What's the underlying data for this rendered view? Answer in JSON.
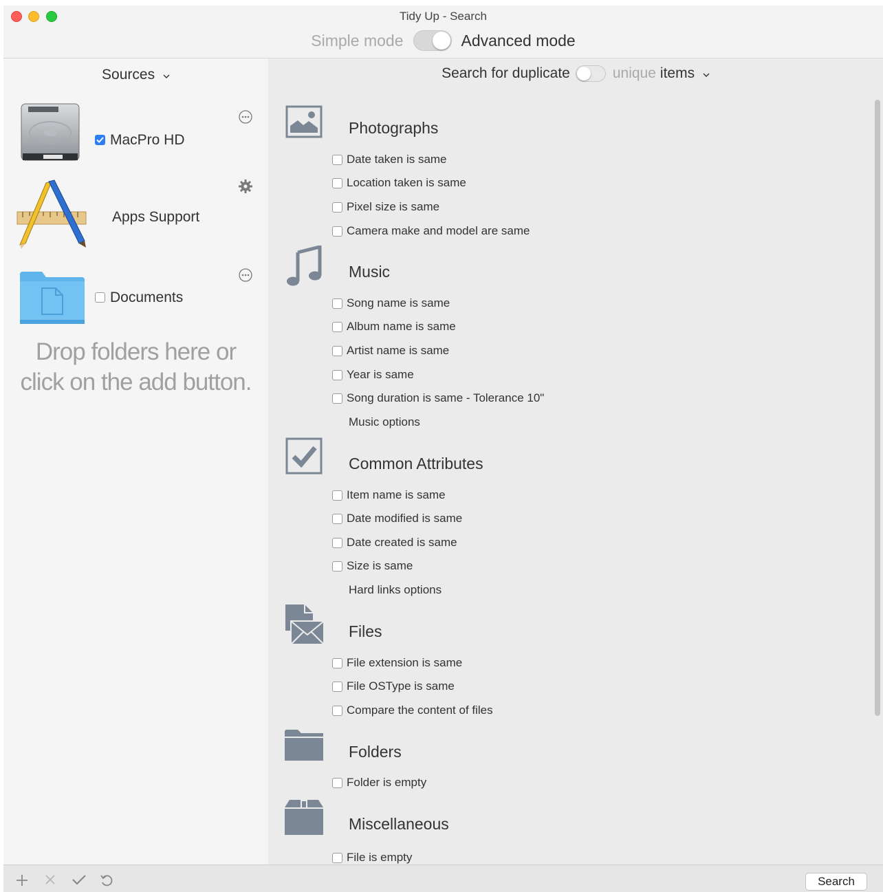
{
  "window": {
    "title": "Tidy Up - Search"
  },
  "mode": {
    "simple_label": "Simple mode",
    "advanced_label": "Advanced mode",
    "advanced_on": true
  },
  "sidebar": {
    "title": "Sources",
    "sources": [
      {
        "label": "MacPro HD",
        "checked": true,
        "icon": "hard-drive-icon",
        "action": "more-icon"
      },
      {
        "label": "Apps Support",
        "icon": "app-support-icon",
        "action": "gear-icon"
      },
      {
        "label": "Documents",
        "checked": false,
        "icon": "folder-icon",
        "action": "more-icon"
      }
    ],
    "drop_hint_line1": "Drop folders here or",
    "drop_hint_line2": "click on the add button."
  },
  "search_for": {
    "prefix": "Search for duplicate",
    "unique_word": "unique",
    "items_word": "items"
  },
  "sections": [
    {
      "title": "Photographs",
      "icon": "photo-icon",
      "options": [
        "Date taken is same",
        "Location taken is same",
        "Pixel size is same",
        "Camera make and model are same"
      ]
    },
    {
      "title": "Music",
      "icon": "music-note-icon",
      "options": [
        "Song name is same",
        "Album name is same",
        "Artist name is same",
        "Year is same",
        "Song duration is same - Tolerance 10\""
      ],
      "link": "Music options"
    },
    {
      "title": "Common Attributes",
      "icon": "checkmark-box-icon",
      "options": [
        "Item name is same",
        "Date modified is same",
        "Date created is same",
        "Size is same"
      ],
      "link": "Hard links options"
    },
    {
      "title": "Files",
      "icon": "files-icon",
      "options": [
        "File extension is same",
        "File OSType is same",
        "Compare the content of files"
      ]
    },
    {
      "title": "Folders",
      "icon": "folder-icon",
      "options": [
        "Folder is empty"
      ]
    },
    {
      "title": "Miscellaneous",
      "icon": "box-icon",
      "options": [
        "File is empty"
      ]
    }
  ],
  "bottom_bar": {
    "icons": [
      "add-icon",
      "remove-icon",
      "check-icon",
      "undo-icon"
    ],
    "search_label": "Search"
  },
  "colors": {
    "accent": "#2f7ff4",
    "section_icon": "#7b8794",
    "folder_blue": "#5eb6ec"
  }
}
